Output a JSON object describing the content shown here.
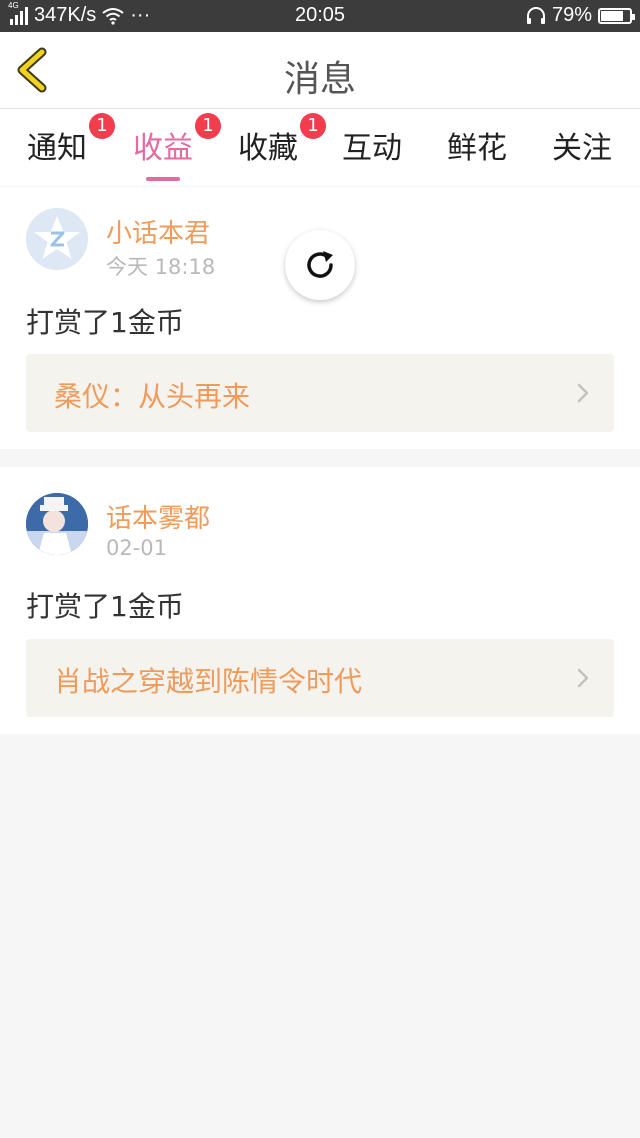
{
  "status_bar": {
    "network_label": "4G",
    "speed": "347K/s",
    "dots": "···",
    "time": "20:05",
    "battery": "79%",
    "battery_level": 0.79
  },
  "header": {
    "title": "消息",
    "back_icon": "chevron-left-icon"
  },
  "tabs": [
    {
      "label": "通知",
      "badge": "1"
    },
    {
      "label": "收益",
      "badge": "1"
    },
    {
      "label": "收藏",
      "badge": "1"
    },
    {
      "label": "互动"
    },
    {
      "label": "鲜花"
    },
    {
      "label": "关注"
    }
  ],
  "active_tab": "收益",
  "messages": [
    {
      "username": "小话本君",
      "time": "今天 18:18",
      "text": "打赏了1金币",
      "book_title": "桑仪：从头再来"
    },
    {
      "username": "话本雾都",
      "time": "02-01",
      "text": "打赏了1金币",
      "book_title": "肖战之穿越到陈情令时代"
    }
  ],
  "colors": {
    "accent_pink": "#e46aa0",
    "accent_orange": "#ef9b5c",
    "badge_red": "#f23d4f",
    "back_arrow": "#f2d21b"
  }
}
